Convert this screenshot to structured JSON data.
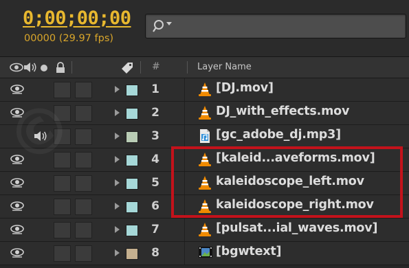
{
  "timecode": "0;00;00;00",
  "frame_info": "00000 (29.97 fps)",
  "search": {
    "placeholder": ""
  },
  "header": {
    "hash": "#",
    "layer_name": "Layer Name"
  },
  "colors": {
    "timecode": "#e8b82f",
    "highlight": "#c3121b",
    "swatch_teal": "#a6d8d8",
    "swatch_gray_green": "#b9ccb5",
    "swatch_tan": "#c5b08f"
  },
  "layers": [
    {
      "num": "1",
      "name": "[DJ.mov]",
      "type": "vlc-icon",
      "eye": true,
      "audio": false,
      "swatch": "#a6d8d8"
    },
    {
      "num": "2",
      "name": "DJ_with_effects.mov",
      "type": "vlc-icon",
      "eye": true,
      "audio": false,
      "swatch": "#a6d8d8"
    },
    {
      "num": "3",
      "name": "[gc_adobe_dj.mp3]",
      "type": "audio-file-icon",
      "eye": false,
      "audio": true,
      "swatch": "#b9ccb5"
    },
    {
      "num": "4",
      "name": "[kaleid...aveforms.mov]",
      "type": "vlc-icon",
      "eye": true,
      "audio": false,
      "swatch": "#a6d8d8"
    },
    {
      "num": "5",
      "name": "kaleidoscope_left.mov",
      "type": "vlc-icon",
      "eye": true,
      "audio": false,
      "swatch": "#a6d8d8"
    },
    {
      "num": "6",
      "name": "kaleidoscope_right.mov",
      "type": "vlc-icon",
      "eye": true,
      "audio": false,
      "swatch": "#a6d8d8"
    },
    {
      "num": "7",
      "name": "[pulsat...ial_waves.mov]",
      "type": "vlc-icon",
      "eye": true,
      "audio": false,
      "swatch": "#a6d8d8"
    },
    {
      "num": "8",
      "name": "[bgwtext]",
      "type": "image-sequence-icon",
      "eye": true,
      "audio": false,
      "swatch": "#c5b08f"
    }
  ]
}
